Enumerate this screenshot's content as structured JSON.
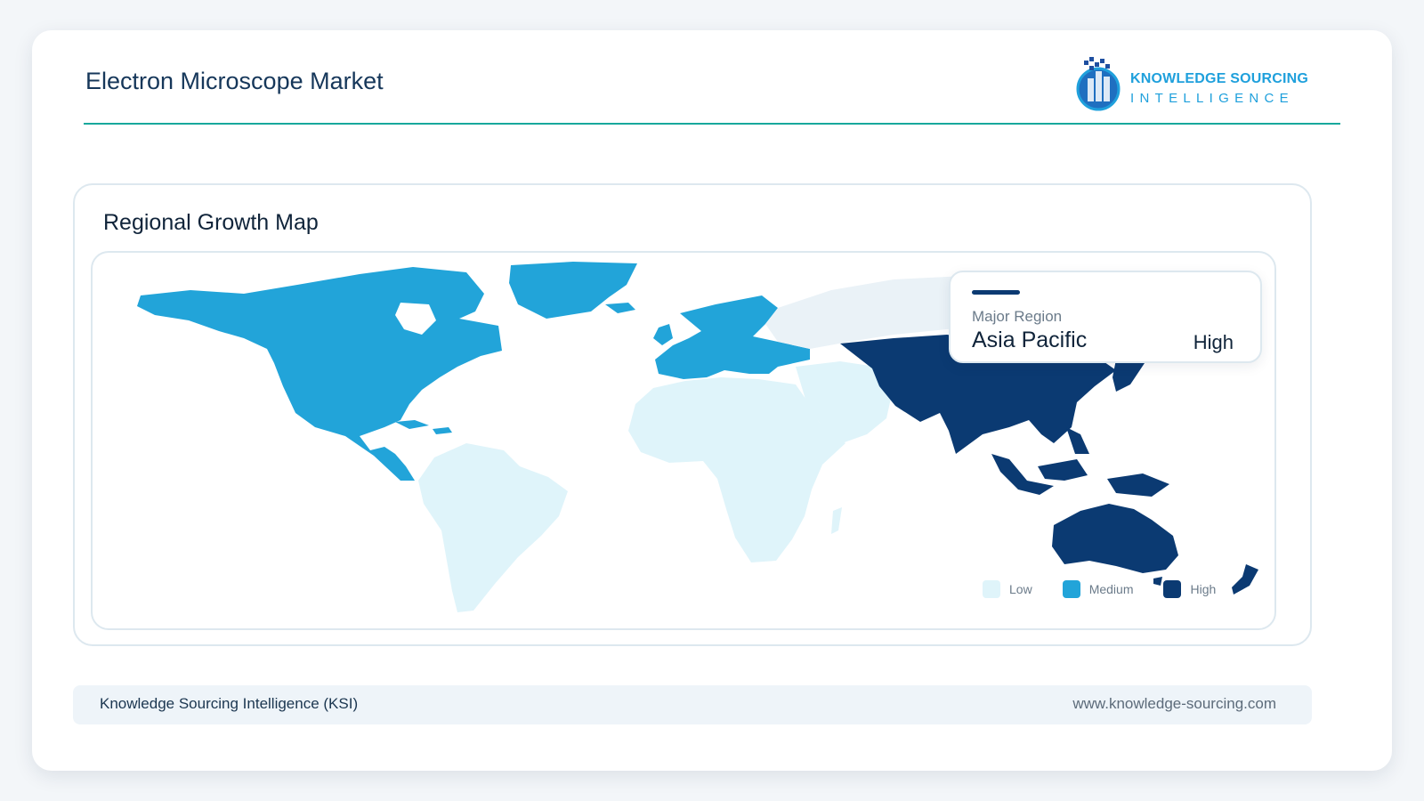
{
  "header": {
    "title": "Electron Microscope Market"
  },
  "logo": {
    "line1": "KNOWLEDGE SOURCING",
    "line2": "INTELLIGENCE",
    "icon": "ksi-logo-icon"
  },
  "panel": {
    "title": "Regional Growth Map"
  },
  "tooltip": {
    "label": "Major Region",
    "region": "Asia Pacific",
    "value": "High"
  },
  "legend": [
    {
      "label": "Low",
      "color": "#dff4fa"
    },
    {
      "label": "Medium",
      "color": "#22a4d9"
    },
    {
      "label": "High",
      "color": "#0b3a72"
    }
  ],
  "map_data": {
    "type": "choropleth",
    "regions": [
      {
        "name": "North America",
        "level": "Medium"
      },
      {
        "name": "Europe",
        "level": "Medium"
      },
      {
        "name": "Asia Pacific",
        "level": "High"
      },
      {
        "name": "South America",
        "level": "Low"
      },
      {
        "name": "Middle East and Africa",
        "level": "Low"
      }
    ]
  },
  "footer": {
    "left": "Knowledge Sourcing Intelligence (KSI)",
    "right": "www.knowledge-sourcing.com"
  }
}
